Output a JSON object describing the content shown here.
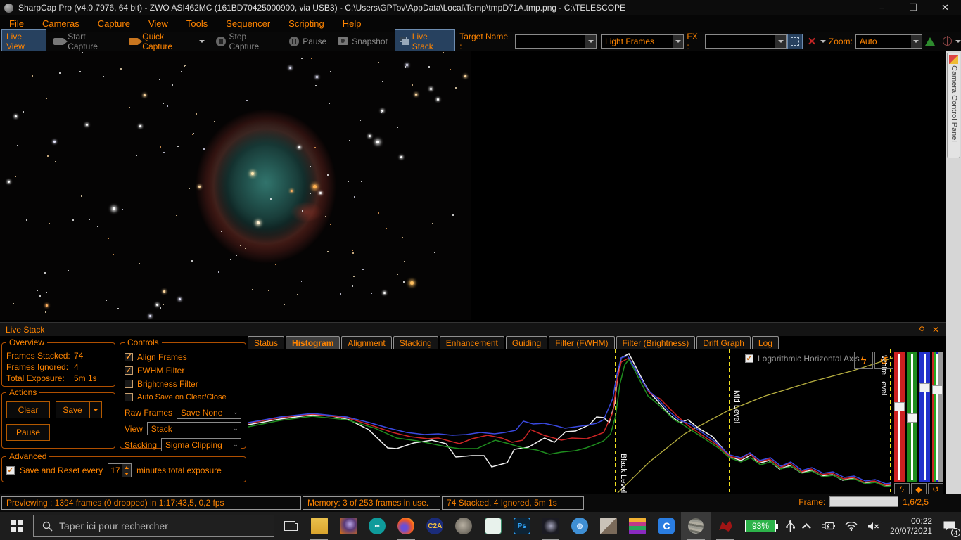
{
  "window": {
    "title": "SharpCap Pro (v4.0.7976, 64 bit) - ZWO ASI462MC (161BD70425000900, via USB3) - C:\\Users\\GPTov\\AppData\\Local\\Temp\\tmpD71A.tmp.png - C:\\TELESCOPE",
    "minimize": "−",
    "maximize": "❐",
    "close": "✕"
  },
  "menu_items": [
    "File",
    "Cameras",
    "Capture",
    "View",
    "Tools",
    "Sequencer",
    "Scripting",
    "Help"
  ],
  "toolbar": {
    "live_view": "Live View",
    "start_capture": "Start Capture",
    "quick_capture": "Quick Capture",
    "stop_capture": "Stop Capture",
    "pause": "Pause",
    "snapshot": "Snapshot",
    "live_stack": "Live Stack",
    "target_name_label": "Target Name :",
    "target_name_value": "",
    "frame_type_value": "Light Frames",
    "fx_label": "FX :",
    "fx_value": "",
    "zoom_label": "Zoom:",
    "zoom_value": "Auto"
  },
  "camera_panel": {
    "tab_label": "Camera Control Panel"
  },
  "live_stack": {
    "title": "Live Stack",
    "pin_icon": "⚲",
    "close_icon": "✕",
    "overview": {
      "legend": "Overview",
      "stacked_label": "Frames Stacked:",
      "stacked_value": "74",
      "ignored_label": "Frames Ignored:",
      "ignored_value": "4",
      "exposure_label": "Total Exposure:",
      "exposure_value": "5m 1s"
    },
    "actions": {
      "legend": "Actions",
      "clear": "Clear",
      "save": "Save",
      "pause": "Pause"
    },
    "controls": {
      "legend": "Controls",
      "align_label": "Align Frames",
      "align_check": "✓",
      "fwhm_label": "FWHM Filter",
      "fwhm_check": "✓",
      "brightness_label": "Brightness Filter",
      "brightness_check": "",
      "autosave_label": "Auto Save on Clear/Close",
      "autosave_check": "",
      "raw_frames_label": "Raw Frames",
      "raw_frames_value": "Save None",
      "view_label": "View",
      "view_value": "Stack",
      "stacking_label": "Stacking",
      "stacking_value": "Sigma Clipping"
    },
    "advanced": {
      "legend": "Advanced",
      "check": "✓",
      "save_reset_label": "Save and Reset every",
      "minutes_value": "17",
      "suffix_label": "minutes total exposure"
    },
    "tabs": [
      "Status",
      "Histogram",
      "Alignment",
      "Stacking",
      "Enhancement",
      "Guiding",
      "Filter (FWHM)",
      "Filter (Brightness)",
      "Drift Graph",
      "Log"
    ],
    "active_tab": "Histogram"
  },
  "histogram": {
    "log_axis_label": "Logarithmic Horizontal Axis",
    "log_axis_check": "✓",
    "black_level_label": "Black Level",
    "mid_level_label": "Mid Level",
    "white_level_label": "White Level",
    "stretch_icon": "ϟ",
    "highlight_icon": "◆",
    "reset_icon": "↺",
    "chart_data": {
      "type": "line",
      "plot_size": [
        916,
        205
      ],
      "guide_lines_x": {
        "black": 522,
        "mid": 684,
        "white": 913
      },
      "guide_color": "#f0e020",
      "transfer_curve": {
        "color": "#b8b040",
        "points": [
          [
            525,
            204
          ],
          [
            570,
            160
          ],
          [
            620,
            120
          ],
          [
            680,
            88
          ],
          [
            735,
            66
          ],
          [
            800,
            46
          ],
          [
            860,
            30
          ],
          [
            916,
            12
          ]
        ]
      },
      "series": [
        {
          "name": "white",
          "color": "#f0f0f0",
          "points": [
            [
              0,
              107
            ],
            [
              45,
              99
            ],
            [
              91,
              93
            ],
            [
              120,
              95
            ],
            [
              143,
              100
            ],
            [
              171,
              114
            ],
            [
              198,
              140
            ],
            [
              211,
              141
            ],
            [
              235,
              133
            ],
            [
              261,
              129
            ],
            [
              281,
              134
            ],
            [
              295,
              153
            ],
            [
              318,
              151
            ],
            [
              335,
              151
            ],
            [
              346,
              167
            ],
            [
              368,
              161
            ],
            [
              378,
              142
            ],
            [
              398,
              139
            ],
            [
              421,
              126
            ],
            [
              435,
              132
            ],
            [
              451,
              117
            ],
            [
              465,
              116
            ],
            [
              485,
              107
            ],
            [
              495,
              96
            ],
            [
              505,
              97
            ],
            [
              513,
              104
            ],
            [
              520,
              80
            ],
            [
              525,
              40
            ],
            [
              530,
              12
            ],
            [
              541,
              6
            ],
            [
              566,
              54
            ],
            [
              575,
              66
            ],
            [
              600,
              94
            ],
            [
              613,
              104
            ],
            [
              625,
              100
            ],
            [
              640,
              112
            ],
            [
              660,
              124
            ],
            [
              684,
              152
            ],
            [
              700,
              158
            ],
            [
              715,
              150
            ],
            [
              725,
              162
            ],
            [
              740,
              158
            ],
            [
              755,
              170
            ],
            [
              770,
              165
            ],
            [
              785,
              175
            ],
            [
              800,
              172
            ],
            [
              815,
              180
            ],
            [
              830,
              178
            ],
            [
              845,
              186
            ],
            [
              860,
              183
            ],
            [
              875,
              190
            ],
            [
              890,
              188
            ],
            [
              905,
              194
            ],
            [
              913,
              193
            ]
          ]
        },
        {
          "name": "red",
          "color": "#cc2525",
          "points": [
            [
              0,
              105
            ],
            [
              45,
              97
            ],
            [
              91,
              92
            ],
            [
              140,
              97
            ],
            [
              175,
              108
            ],
            [
              205,
              118
            ],
            [
              230,
              124
            ],
            [
              255,
              127
            ],
            [
              270,
              126
            ],
            [
              285,
              130
            ],
            [
              300,
              134
            ],
            [
              318,
              127
            ],
            [
              340,
              122
            ],
            [
              360,
              126
            ],
            [
              375,
              132
            ],
            [
              390,
              129
            ],
            [
              401,
              114
            ],
            [
              420,
              122
            ],
            [
              445,
              129
            ],
            [
              460,
              126
            ],
            [
              481,
              127
            ],
            [
              495,
              122
            ],
            [
              505,
              118
            ],
            [
              518,
              90
            ],
            [
              524,
              45
            ],
            [
              530,
              18
            ],
            [
              541,
              12
            ],
            [
              570,
              62
            ],
            [
              585,
              70
            ],
            [
              600,
              85
            ],
            [
              610,
              95
            ],
            [
              625,
              108
            ],
            [
              645,
              122
            ],
            [
              665,
              135
            ],
            [
              684,
              152
            ],
            [
              700,
              156
            ],
            [
              712,
              148
            ],
            [
              726,
              160
            ],
            [
              741,
              156
            ],
            [
              756,
              168
            ],
            [
              770,
              162
            ],
            [
              786,
              174
            ],
            [
              800,
              170
            ],
            [
              816,
              178
            ],
            [
              830,
              176
            ],
            [
              846,
              184
            ],
            [
              860,
              182
            ],
            [
              876,
              189
            ],
            [
              890,
              187
            ],
            [
              905,
              193
            ],
            [
              913,
              192
            ]
          ]
        },
        {
          "name": "green",
          "color": "#1e8c1e",
          "points": [
            [
              0,
              110
            ],
            [
              45,
              101
            ],
            [
              91,
              95
            ],
            [
              140,
              100
            ],
            [
              180,
              112
            ],
            [
              211,
              126
            ],
            [
              240,
              130
            ],
            [
              265,
              135
            ],
            [
              285,
              139
            ],
            [
              300,
              141
            ],
            [
              325,
              141
            ],
            [
              351,
              129
            ],
            [
              370,
              134
            ],
            [
              390,
              140
            ],
            [
              410,
              143
            ],
            [
              428,
              149
            ],
            [
              445,
              146
            ],
            [
              465,
              144
            ],
            [
              480,
              140
            ],
            [
              491,
              136
            ],
            [
              505,
              130
            ],
            [
              515,
              120
            ],
            [
              522,
              95
            ],
            [
              528,
              50
            ],
            [
              535,
              22
            ],
            [
              541,
              14
            ],
            [
              568,
              66
            ],
            [
              580,
              76
            ],
            [
              595,
              90
            ],
            [
              605,
              100
            ],
            [
              615,
              105
            ],
            [
              630,
              115
            ],
            [
              650,
              128
            ],
            [
              668,
              140
            ],
            [
              684,
              154
            ],
            [
              700,
              160
            ],
            [
              714,
              154
            ],
            [
              728,
              164
            ],
            [
              742,
              160
            ],
            [
              757,
              170
            ],
            [
              772,
              166
            ],
            [
              787,
              176
            ],
            [
              801,
              173
            ],
            [
              817,
              181
            ],
            [
              831,
              179
            ],
            [
              847,
              186
            ],
            [
              861,
              184
            ],
            [
              877,
              191
            ],
            [
              891,
              189
            ],
            [
              906,
              195
            ],
            [
              913,
              194
            ]
          ]
        },
        {
          "name": "blue",
          "color": "#3a49e0",
          "points": [
            [
              0,
              104
            ],
            [
              45,
              96
            ],
            [
              91,
              91
            ],
            [
              140,
              96
            ],
            [
              172,
              104
            ],
            [
              200,
              112
            ],
            [
              225,
              118
            ],
            [
              250,
              121
            ],
            [
              270,
              120
            ],
            [
              290,
              122
            ],
            [
              310,
              121
            ],
            [
              330,
              118
            ],
            [
              350,
              120
            ],
            [
              365,
              118
            ],
            [
              380,
              115
            ],
            [
              391,
              102
            ],
            [
              405,
              106
            ],
            [
              420,
              105
            ],
            [
              435,
              108
            ],
            [
              450,
              112
            ],
            [
              465,
              110
            ],
            [
              480,
              108
            ],
            [
              495,
              105
            ],
            [
              505,
              100
            ],
            [
              518,
              70
            ],
            [
              524,
              35
            ],
            [
              530,
              12
            ],
            [
              539,
              9
            ],
            [
              568,
              58
            ],
            [
              580,
              68
            ],
            [
              598,
              88
            ],
            [
              612,
              100
            ],
            [
              628,
              106
            ],
            [
              645,
              118
            ],
            [
              662,
              130
            ],
            [
              684,
              150
            ],
            [
              700,
              154
            ],
            [
              713,
              147
            ],
            [
              727,
              158
            ],
            [
              742,
              154
            ],
            [
              757,
              166
            ],
            [
              771,
              160
            ],
            [
              787,
              172
            ],
            [
              801,
              168
            ],
            [
              817,
              176
            ],
            [
              831,
              174
            ],
            [
              847,
              182
            ],
            [
              861,
              180
            ],
            [
              877,
              187
            ],
            [
              891,
              185
            ],
            [
              906,
              191
            ],
            [
              913,
              190
            ]
          ]
        }
      ],
      "sliders": [
        {
          "name": "red-channel",
          "handle_top": 71
        },
        {
          "name": "green-channel",
          "handle_top": 87
        },
        {
          "name": "blue-channel",
          "handle_top": 44
        },
        {
          "name": "all-channels",
          "handle_top": 47
        }
      ]
    }
  },
  "status_bar": {
    "segment1": "Previewing : 1394 frames (0 dropped) in 1:17:43,5, 0,2 fps",
    "segment2": "Memory: 3 of 253 frames in use.",
    "segment3": "74 Stacked, 4 Ignored, 5m 1s",
    "frame_label": "Frame:",
    "frame_value": "1,6/2,5",
    "frame_progress_pct": 30
  },
  "taskbar": {
    "search_placeholder": "Taper ici pour rechercher",
    "battery": "93%",
    "time": "00:22",
    "date": "20/07/2021",
    "notification_count": "4",
    "app_icons": [
      "file-explorer",
      "sharpcap",
      "arduino",
      "firefox",
      "c2a",
      "cartes-du-ciel",
      "spreadsheet",
      "photoshop",
      "deepsky",
      "stellarium",
      "photos",
      "scratch",
      "clipchamp"
    ],
    "tray_icons": [
      "planetarium",
      "apt-dragon",
      "battery",
      "usb",
      "hidden-icons-chevron",
      "power",
      "wifi",
      "volume-muted",
      "clock",
      "notifications"
    ]
  }
}
